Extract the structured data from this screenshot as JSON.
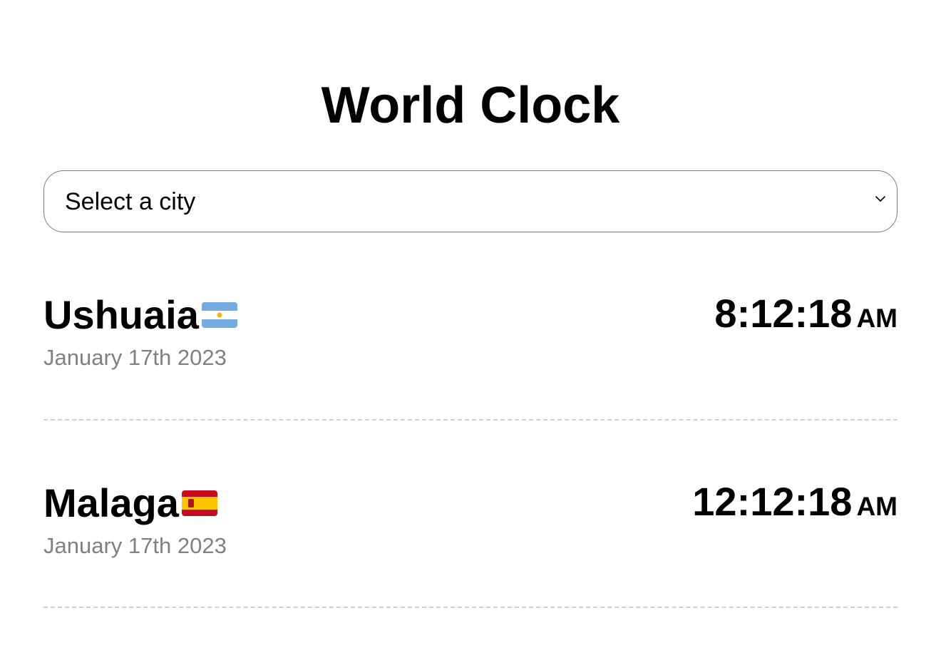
{
  "header": {
    "title": "World Clock"
  },
  "city_select": {
    "selected_label": "Select a city"
  },
  "cities": [
    {
      "name": "Ushuaia",
      "flag_icon": "argentina-flag-icon",
      "date": "January 17th 2023",
      "time": "8:12:18",
      "ampm": "AM"
    },
    {
      "name": "Malaga",
      "flag_icon": "spain-flag-icon",
      "date": "January 17th 2023",
      "time": "12:12:18",
      "ampm": "AM"
    }
  ],
  "colors": {
    "text": "#000000",
    "date_text": "#808080",
    "select_border": "#7a7a7a",
    "divider": "#d0d0d0"
  }
}
